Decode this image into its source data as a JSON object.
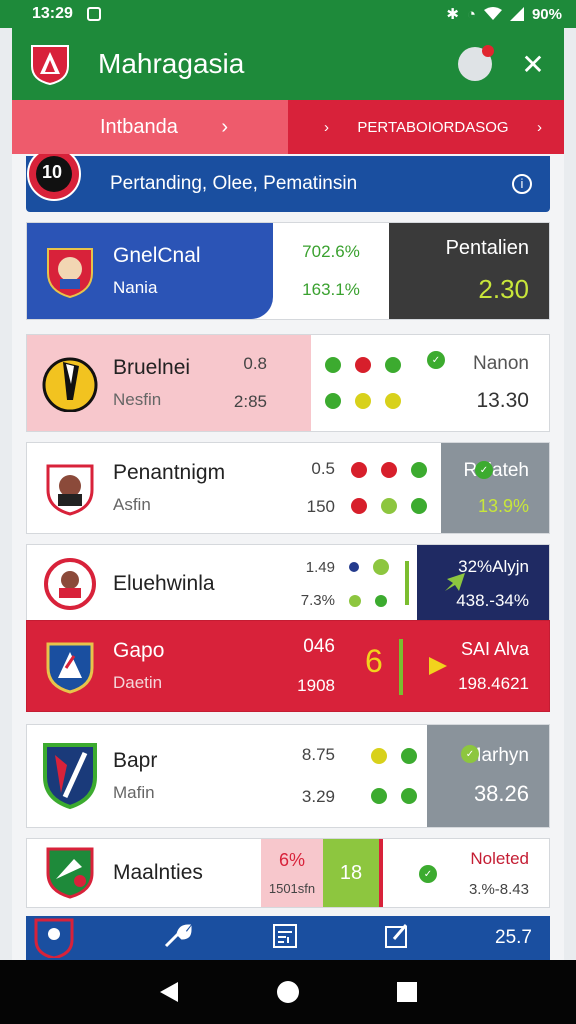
{
  "status_bar": {
    "time": "13:29",
    "battery": "90%"
  },
  "app": {
    "title": "Mahragasia"
  },
  "tabs": [
    {
      "label": "Intbanda",
      "arrow": "›"
    },
    {
      "label": "PERTABOIORDASOG",
      "arrow_left": "›",
      "arrow_right": "›"
    }
  ],
  "banner": {
    "badge_number": "10",
    "text": "Pertanding, Olee, Pematinsin",
    "icon": "info-icon"
  },
  "cards": [
    {
      "team": "GnelCnal",
      "sub": "Nania",
      "stat1": "702.6%",
      "stat2": "163.1%",
      "right_title": "Pentalien",
      "right_value": "2.30"
    },
    {
      "team": "Bruelnei",
      "sub": "Nesfin",
      "stat1": "0.8",
      "stat2": "2:85",
      "right_title": "Nanon",
      "right_value": "13.30"
    },
    {
      "team": "Penantnigm",
      "sub": "Asfin",
      "stat1": "0.5",
      "stat2": "150",
      "right_title": "Rolateh",
      "right_value": "13.9%"
    },
    {
      "team": "Eluehwinla",
      "sub": "",
      "stat1": "1.49",
      "stat2": "7.3%",
      "right_title": "32%Alyjn",
      "right_value": "438.-34%"
    },
    {
      "team": "Gapo",
      "sub": "Daetin",
      "stat1": "046",
      "stat2": "1908",
      "score": "6",
      "right_title": "SAI Alva",
      "right_value": "198.4621"
    },
    {
      "team": "Bapr",
      "sub": "Mafin",
      "stat1": "8.75",
      "stat2": "3.29",
      "right_title": "Marhyn",
      "right_value": "38.26"
    },
    {
      "team": "Maalnties",
      "sub": "",
      "stat1": "6%",
      "stat2": "1501sfn",
      "score": "18",
      "right_title": "Noleted",
      "right_value": "3.%-8.43"
    }
  ],
  "bottom_nav": {
    "value": "25.7",
    "icons": [
      "wrench-icon",
      "list-icon",
      "edit-icon"
    ]
  },
  "colors": {
    "green": "#1e8a3a",
    "blue": "#1a4fa0",
    "red": "#d8223a",
    "pink": "#f7c7cc",
    "gray": "#8a939b",
    "navy": "#1f2a63"
  }
}
